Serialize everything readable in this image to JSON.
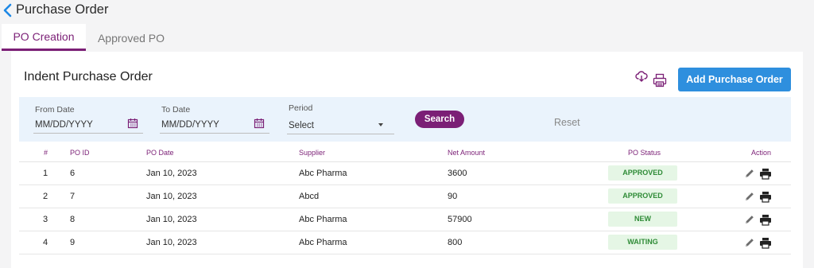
{
  "header": {
    "title": "Purchase Order",
    "back_icon": "chevron-left-icon"
  },
  "tabs": [
    {
      "label": "PO Creation",
      "active": true
    },
    {
      "label": "Approved PO",
      "active": false
    }
  ],
  "section": {
    "title": "Indent Purchase Order",
    "download_icon": "cloud-download-icon",
    "print_icon": "printer-icon",
    "add_button": "Add Purchase Order"
  },
  "filters": {
    "from_date": {
      "label": "From Date",
      "value": "MM/DD/YYYY"
    },
    "to_date": {
      "label": "To Date",
      "value": "MM/DD/YYYY"
    },
    "period": {
      "label": "Period",
      "value": "Select"
    },
    "search_button": "Search",
    "reset_button": "Reset"
  },
  "table": {
    "headers": [
      "#",
      "PO ID",
      "PO Date",
      "Supplier",
      "Net Amount",
      "PO Status",
      "Action"
    ],
    "rows": [
      {
        "num": "1",
        "po_id": "6",
        "date": "Jan 10, 2023",
        "supplier": "Abc Pharma",
        "amount": "3600",
        "status": "APPROVED"
      },
      {
        "num": "2",
        "po_id": "7",
        "date": "Jan 10, 2023",
        "supplier": "Abcd",
        "amount": "90",
        "status": "APPROVED"
      },
      {
        "num": "3",
        "po_id": "8",
        "date": "Jan 10, 2023",
        "supplier": "Abc Pharma",
        "amount": "57900",
        "status": "NEW"
      },
      {
        "num": "4",
        "po_id": "9",
        "date": "Jan 10, 2023",
        "supplier": "Abc Pharma",
        "amount": "800",
        "status": "WAITING"
      }
    ]
  },
  "colors": {
    "brand": "#7b1f76",
    "primary": "#2e8fde",
    "status_bg": "#e5f6e5",
    "status_text": "#2e8b36",
    "filter_bg": "#eaf3fc"
  }
}
